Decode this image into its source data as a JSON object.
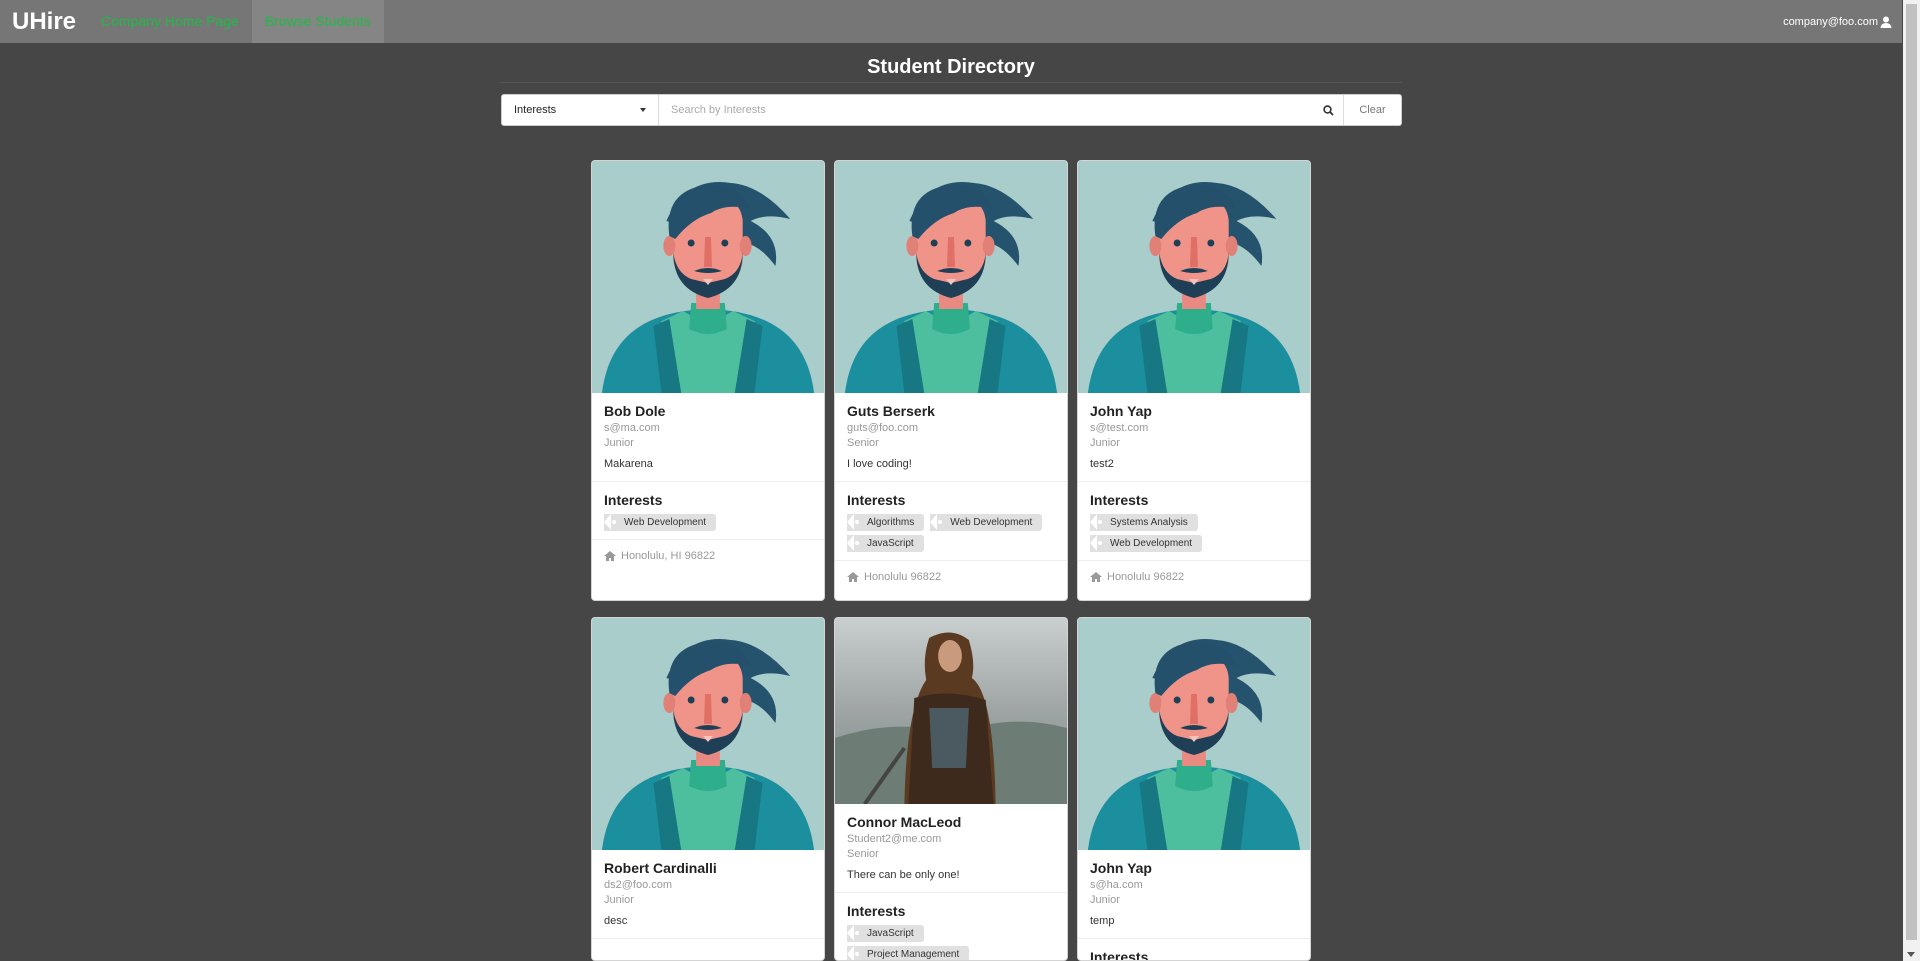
{
  "nav": {
    "brand": "UHire",
    "links": [
      "Company Home Page",
      "Browse Students"
    ],
    "user_email": "company@foo.com"
  },
  "page": {
    "title": "Student Directory"
  },
  "search": {
    "dropdown_value": "Interests",
    "placeholder": "Search by Interests",
    "clear_label": "Clear"
  },
  "interests_label": "Interests",
  "students": [
    {
      "name": "Bob Dole",
      "email": "s@ma.com",
      "level": "Junior",
      "description": "Makarena",
      "interests": [
        "Web Development"
      ],
      "location": "Honolulu, HI 96822"
    },
    {
      "name": "Guts Berserk",
      "email": "guts@foo.com",
      "level": "Senior",
      "description": "I love coding!",
      "interests": [
        "Algorithms",
        "Web Development",
        "JavaScript"
      ],
      "location": "Honolulu 96822"
    },
    {
      "name": "John Yap",
      "email": "s@test.com",
      "level": "Junior",
      "description": "test2",
      "interests": [
        "Systems Analysis",
        "Web Development"
      ],
      "location": "Honolulu 96822"
    },
    {
      "name": "Robert Cardinalli",
      "email": "ds2@foo.com",
      "level": "Junior",
      "description": "desc"
    },
    {
      "name": "Connor MacLeod",
      "email": "Student2@me.com",
      "level": "Senior",
      "description": "There can be only one!",
      "interests": [
        "JavaScript",
        "Project Management"
      ]
    },
    {
      "name": "John Yap",
      "email": "s@ha.com",
      "level": "Junior",
      "description": "temp"
    }
  ],
  "icons": {
    "search": "search-icon",
    "user": "user-icon",
    "home": "home-icon",
    "dropdown": "caret-down-icon"
  },
  "colors": {
    "nav_bg": "#767676",
    "page_bg": "#464646",
    "nav_link": "#21ba45",
    "avatar_bg": "#a9cdcb"
  }
}
